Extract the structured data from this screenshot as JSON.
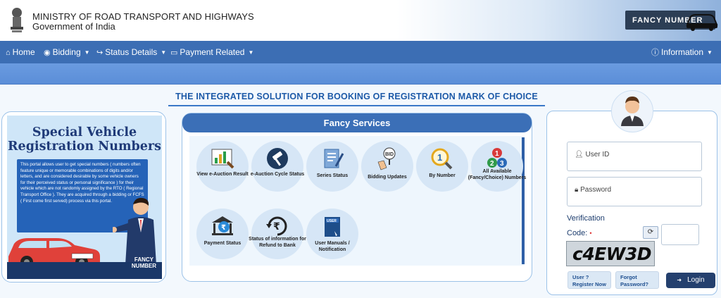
{
  "header": {
    "ministry": "MINISTRY OF ROAD TRANSPORT AND HIGHWAYS",
    "government": "Government of India",
    "badge": "FANCY NUMBER"
  },
  "nav": {
    "items": [
      {
        "label": "Home",
        "icon": "home-icon"
      },
      {
        "label": "Bidding",
        "icon": "eye-icon"
      },
      {
        "label": "Status Details",
        "icon": "arrow-right-icon"
      },
      {
        "label": "Payment Related",
        "icon": "card-icon"
      }
    ],
    "info": "Information"
  },
  "tagline": "THE INTEGRATED SOLUTION FOR BOOKING OF REGISTRATION MARK OF CHOICE",
  "banner": {
    "title_line1": "Special Vehicle",
    "title_line2": "Registration Numbers",
    "text": "This portal allows user to get special numbers ( numbers often feature unique or memorable combinations of digits and/or letters, and are considered desirable by some vehicle owners for their perceived status or personal significance ) for their vehicle which are not randomly assigned by the RTO ( Regional Transport Office ). They are acquired through a bidding or FCFS ( First come first served) process via this portal.",
    "fancy_line1": "FANCY",
    "fancy_line2": "NUMBER"
  },
  "services": {
    "title": "Fancy Services",
    "items": [
      {
        "label": "View e-Auction Result",
        "icon": "auction-chart-icon"
      },
      {
        "label": "e-Auction Cycle Status",
        "icon": "gavel-cycle-icon"
      },
      {
        "label": "Series Status",
        "icon": "document-pen-icon"
      },
      {
        "label": "Bidding Updates",
        "icon": "bid-hand-icon"
      },
      {
        "label": "By Number",
        "icon": "magnifier-number-icon"
      },
      {
        "label": "All Available (Fancy/Choice) Numbers",
        "icon": "numbers-icon"
      },
      {
        "label": "Payment Status",
        "icon": "bank-rupee-icon"
      },
      {
        "label": "Status of information for Refund to Bank",
        "icon": "rupee-refresh-icon"
      },
      {
        "label": "User Manuals / Notification",
        "icon": "user-manual-icon"
      }
    ]
  },
  "login": {
    "user_id_placeholder": "User ID",
    "password_placeholder": "Password",
    "verification": "Verification",
    "code_label": "Code:",
    "captcha": "c4EW3D",
    "register_line1": "User ?",
    "register_line2": "Register Now",
    "forgot_line1": "Forgot",
    "forgot_line2": "Password?",
    "login_label": "Login"
  },
  "colors": {
    "navbar": "#3c6eb4",
    "accent": "#1d5aa8",
    "dark_button": "#24406e"
  }
}
